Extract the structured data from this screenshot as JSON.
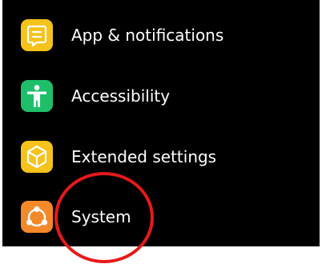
{
  "settings": {
    "items": [
      {
        "label": "App & notifications",
        "icon": "notification-list-icon",
        "color": "#f6c21c"
      },
      {
        "label": "Accessibility",
        "icon": "accessibility-person-icon",
        "color": "#1fbf6a"
      },
      {
        "label": "Extended settings",
        "icon": "cube-icon",
        "color": "#f6c21c"
      },
      {
        "label": "System",
        "icon": "system-share-icon",
        "color": "#f4892a"
      }
    ]
  },
  "annotation": {
    "color": "#e51a1a"
  }
}
